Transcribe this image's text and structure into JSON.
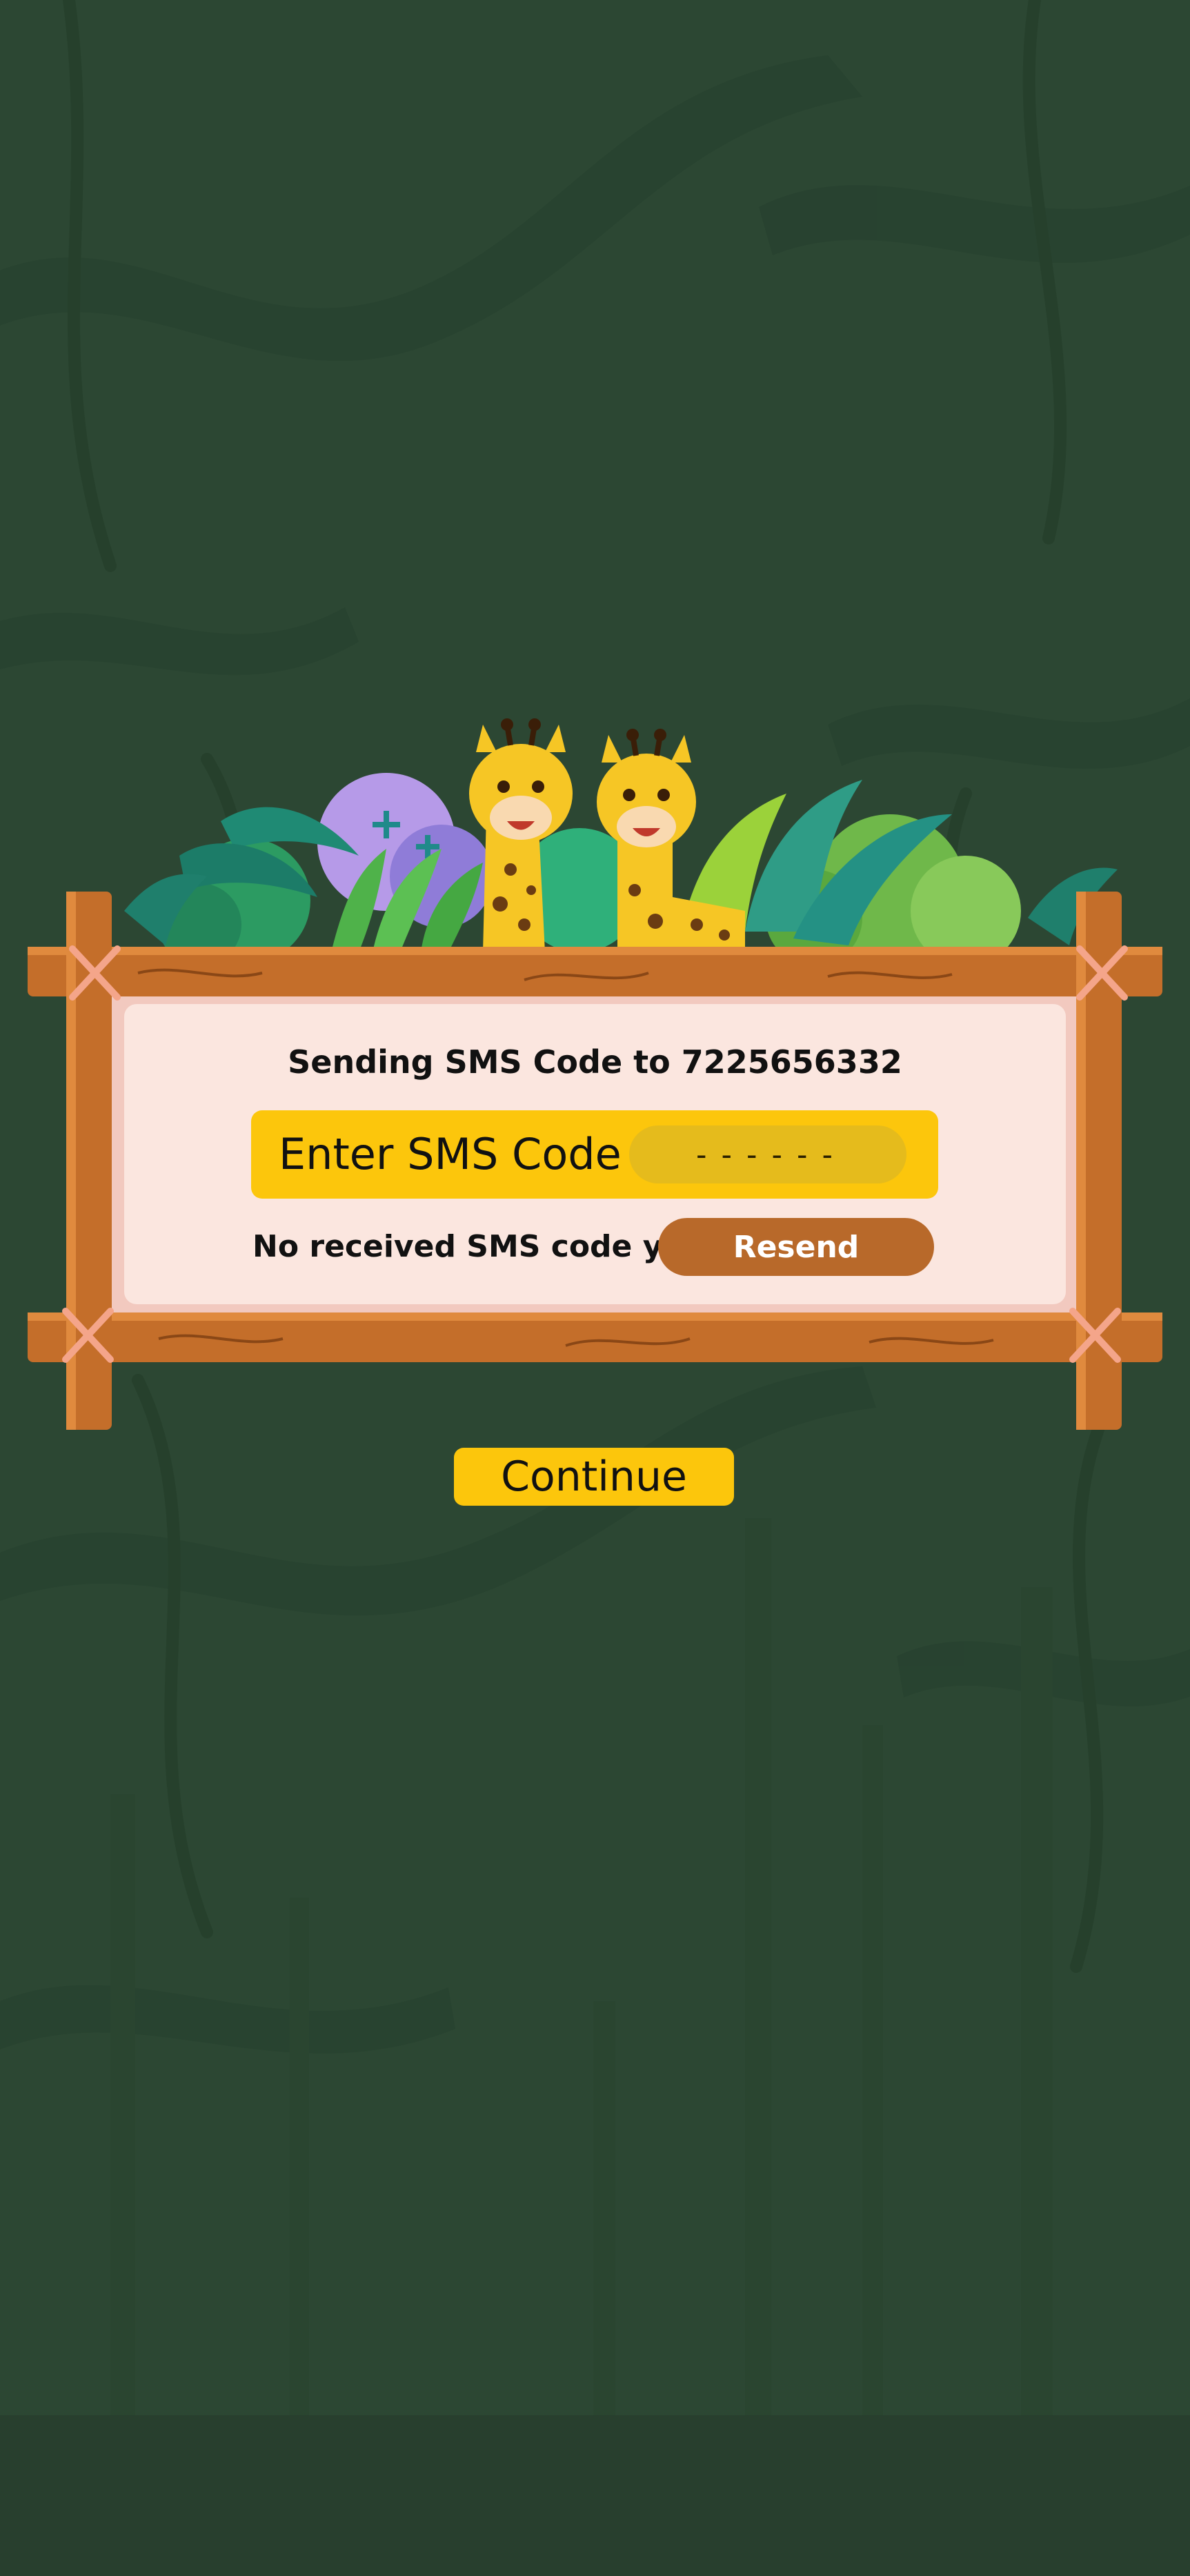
{
  "colors": {
    "background": "#2c4733",
    "panel": "#fbe6df",
    "wood": "#c46e2a",
    "accent_yellow": "#fcc60c",
    "input_fill": "#e5bb1c",
    "resend_brown": "#b8692a"
  },
  "sms_form": {
    "status_text": "Sending SMS Code to 7225656332",
    "field_label": "Enter SMS Code",
    "code_placeholder": "------",
    "resend_question": "No received SMS code yet?",
    "resend_label": "Resend"
  },
  "actions": {
    "continue_label": "Continue"
  },
  "decorations": {
    "mascot": "giraffe-icon",
    "foliage": "jungle-plants-icon",
    "frame": "wooden-frame"
  }
}
